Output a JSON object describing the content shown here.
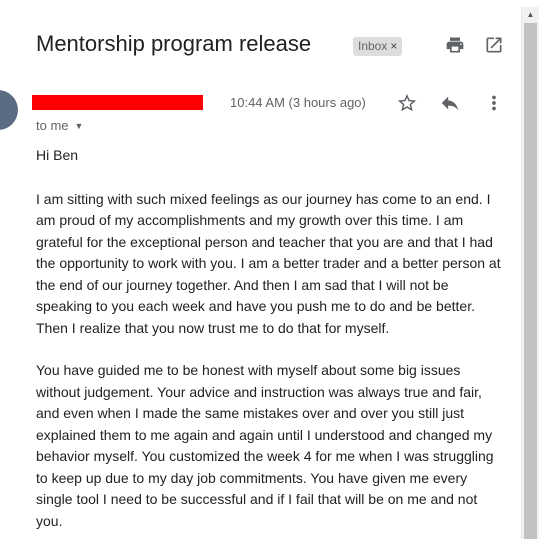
{
  "email": {
    "subject": "Mentorship program release",
    "label_chip": "Inbox",
    "label_remove": "×",
    "sender_redacted": true,
    "timestamp": "10:44 AM (3 hours ago)",
    "recipient": "to me",
    "greeting": "Hi Ben",
    "paragraphs": [
      "I am sitting with such mixed feelings as our journey has come to an end.  I am proud of my accomplishments and my growth over this time.  I am grateful for the exceptional person and teacher that you are and that I had the opportunity to work with you.  I am a better trader and a better person at the end of our journey together.  And then I am sad that I will not be speaking to you each week and have you push me to do and be better.  Then I realize that you now trust me to do that for myself.",
      "You have guided me to be honest with myself about some big issues without judgement.  Your advice and instruction was always true and fair, and even when I made the same mistakes over and over you still just explained them to me again and again until I understood and changed my behavior myself.  You customized the week 4 for me when I was struggling to keep up due to my day job commitments.  You have given me every single tool I need to be successful and if I fail that will be on me and not you."
    ]
  },
  "icons": {
    "print": "print-icon",
    "open_new_window": "open-in-new-window-icon",
    "star": "star-icon",
    "reply": "reply-icon",
    "more": "more-vert-icon",
    "recipient_caret": "caret-down-icon"
  },
  "colors": {
    "redaction": "#ff0000",
    "chip_bg": "#dddddd",
    "icon": "#5f6368"
  }
}
